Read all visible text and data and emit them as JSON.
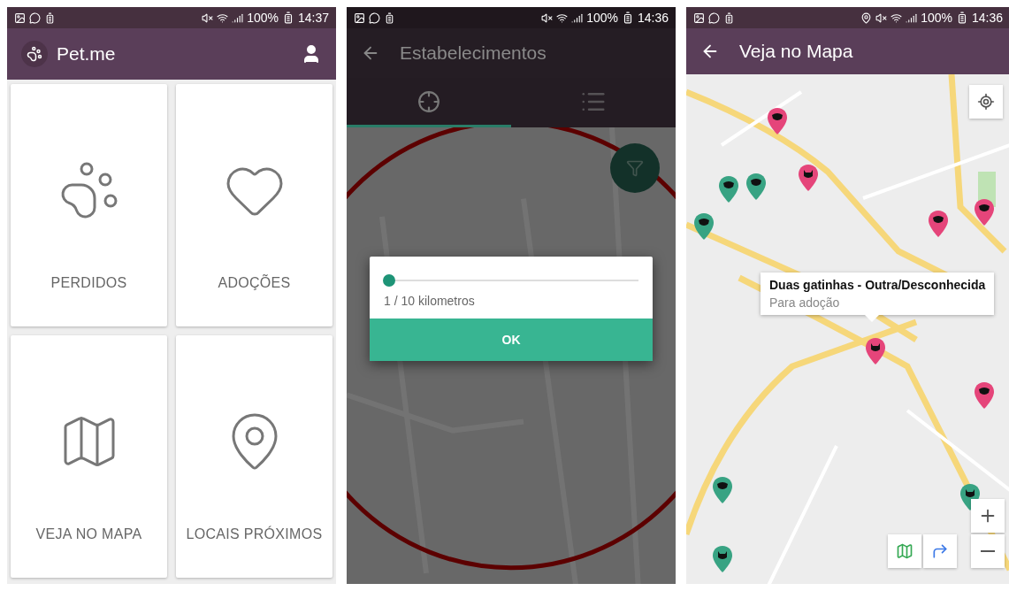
{
  "home_screen": {
    "status_bar": {
      "battery": "100%",
      "time": "14:37"
    },
    "app_bar": {
      "title": "Pet.me"
    },
    "menu": [
      {
        "label": "PERDIDOS",
        "kind": "paw"
      },
      {
        "label": "ADOÇÕES",
        "kind": "heart"
      },
      {
        "label": "VEJA NO MAPA",
        "kind": "map"
      },
      {
        "label": "LOCAIS PRÓXIMOS",
        "kind": "pin"
      }
    ]
  },
  "places_screen": {
    "status_bar": {
      "battery": "100%",
      "time": "14:36"
    },
    "app_bar": {
      "title": "Estabelecimentos"
    },
    "tabs": [
      {
        "kind": "location",
        "selected": true
      },
      {
        "kind": "list",
        "selected": false
      }
    ],
    "dialog": {
      "slider": {
        "level": 0
      },
      "reading": "1 / 10 kilometros",
      "button": "OK"
    }
  },
  "map_screen": {
    "status_bar": {
      "battery": "100%",
      "time": "14:36"
    },
    "app_bar": {
      "title": "Veja no Mapa"
    },
    "markers": [
      {
        "kind": "dog",
        "color": "#e5457a"
      },
      {
        "kind": "cat",
        "color": "#e5457a"
      },
      {
        "kind": "dog",
        "color": "#38a383"
      },
      {
        "kind": "dog",
        "color": "#38a383"
      },
      {
        "kind": "dog",
        "color": "#38a383"
      },
      {
        "kind": "dog",
        "color": "#e5457a"
      },
      {
        "kind": "dog",
        "color": "#e5457a"
      },
      {
        "kind": "cat",
        "color": "#e5457a"
      },
      {
        "kind": "dog",
        "color": "#e5457a"
      },
      {
        "kind": "dog",
        "color": "#38a383"
      },
      {
        "kind": "cat",
        "color": "#38a383"
      },
      {
        "kind": "cat",
        "color": "#38a383"
      }
    ],
    "info_window": {
      "title": "Duas gatinhas - Outra/Desconhecida",
      "subtitle": "Para adoção"
    }
  }
}
